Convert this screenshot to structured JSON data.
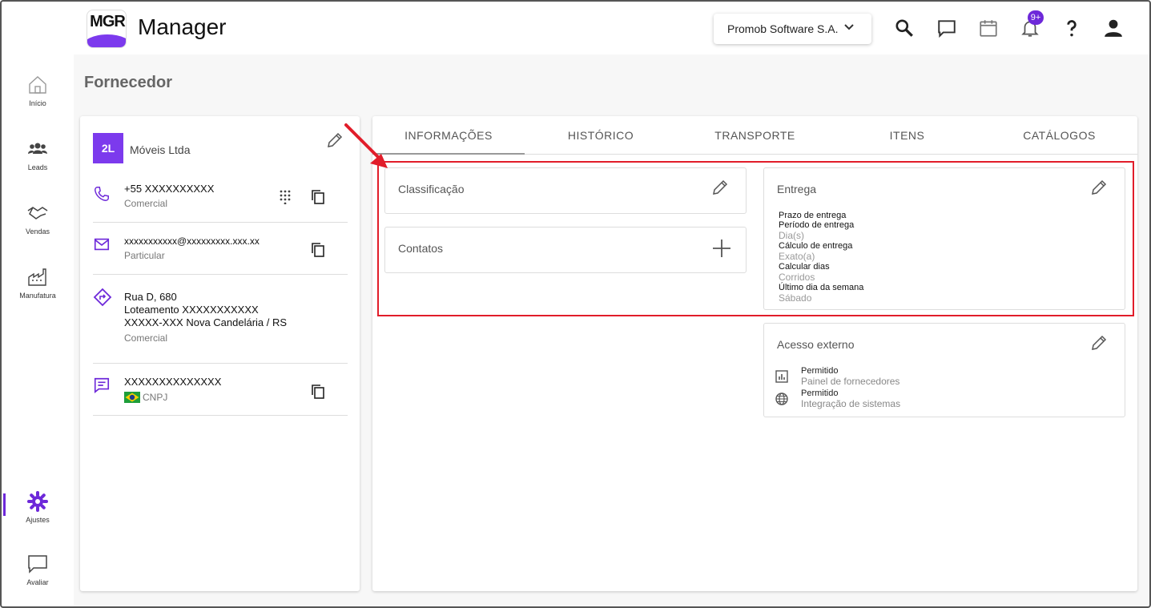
{
  "header": {
    "logo_text": "MGR",
    "app_title": "Manager",
    "company": "Promob Software S.A.",
    "notification_badge": "9+"
  },
  "sidebar": {
    "items": [
      {
        "label": "Início",
        "icon": "home-icon"
      },
      {
        "label": "Leads",
        "icon": "people-icon"
      },
      {
        "label": "Vendas",
        "icon": "handshake-icon"
      },
      {
        "label": "Manufatura",
        "icon": "factory-icon"
      },
      {
        "label": "Ajustes",
        "icon": "gear-icon"
      },
      {
        "label": "Avaliar",
        "icon": "chat-bubble-icon"
      }
    ],
    "active": "Ajustes"
  },
  "page": {
    "title": "Fornecedor"
  },
  "supplier": {
    "avatar": "2L",
    "name": "Móveis Ltda",
    "phone": "+55 XXXXXXXXXX",
    "phone_type": "Comercial",
    "email": "xxxxxxxxxxx@xxxxxxxxx.xxx.xx",
    "email_type": "Particular",
    "address_line1": "Rua D, 680",
    "address_line2": "Loteamento  XXXXXXXXXXX",
    "address_line3": "XXXXX-XXX",
    "address_city": "Nova Candelária / RS",
    "address_type": "Comercial",
    "document": "XXXXXXXXXXXXXX",
    "document_type": "CNPJ"
  },
  "tabs": [
    "INFORMAÇÕES",
    "HISTÓRICO",
    "TRANSPORTE",
    "ITENS",
    "CATÁLOGOS"
  ],
  "classificacao": {
    "title": "Classificação"
  },
  "contatos": {
    "title": "Contatos"
  },
  "entrega": {
    "title": "Entrega",
    "fields": [
      {
        "label": "Prazo de entrega",
        "value": ""
      },
      {
        "label": "Período de entrega",
        "value": "Dia(s)"
      },
      {
        "label": "Cálculo de entrega",
        "value": "Exato(a)"
      },
      {
        "label": "Calcular dias",
        "value": "Corridos"
      },
      {
        "label": "Último dia da semana",
        "value": "Sábado"
      }
    ]
  },
  "acesso": {
    "title": "Acesso externo",
    "items": [
      {
        "label": "Permitido",
        "value": "Painel de fornecedores",
        "icon": "chart-icon"
      },
      {
        "label": "Permitido",
        "value": "Integração de sistemas",
        "icon": "globe-icon"
      }
    ]
  },
  "colors": {
    "accent": "#7c3aed",
    "highlight": "#e11d2a"
  }
}
